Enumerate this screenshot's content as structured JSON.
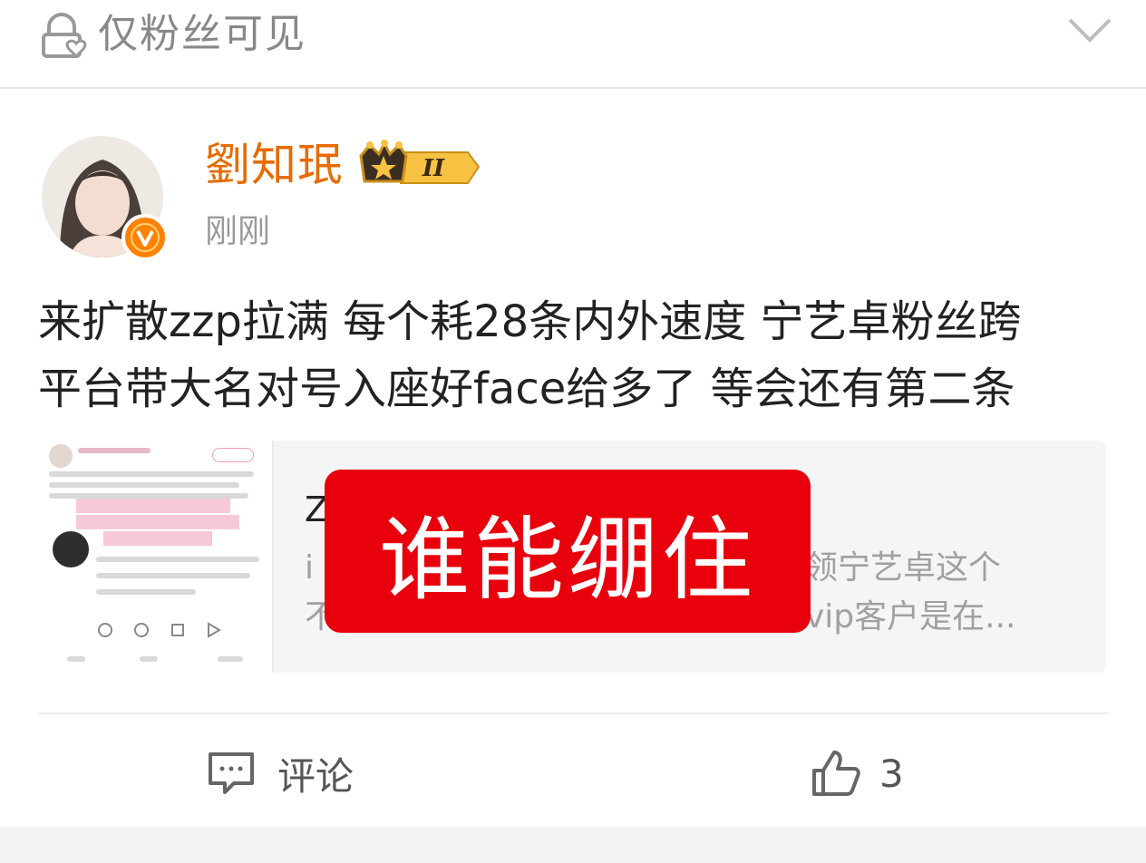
{
  "visibility": {
    "label": "仅粉丝可见"
  },
  "author": {
    "name": "劉知珉",
    "rank_badge": "II",
    "time": "刚刚",
    "verified_badge": "V"
  },
  "post": {
    "lines": [
      "来扩散zzp拉满 每个耗28条内外速度 宁艺卓粉丝跨",
      "平台带大名对号入座好face给多了 等会还有第二条"
    ]
  },
  "link_card": {
    "title": "Z",
    "desc_lines": [
      "i",
      "不"
    ],
    "desc_right": [
      "领宁艺卓这个",
      "vip客户是在..."
    ]
  },
  "sticker": {
    "text": "谁能绷住"
  },
  "actions": {
    "comment_label": "评论",
    "like_count": "3"
  },
  "colors": {
    "username": "#e86b00",
    "badge": "#ff8200",
    "sticker": "#e8000d"
  }
}
